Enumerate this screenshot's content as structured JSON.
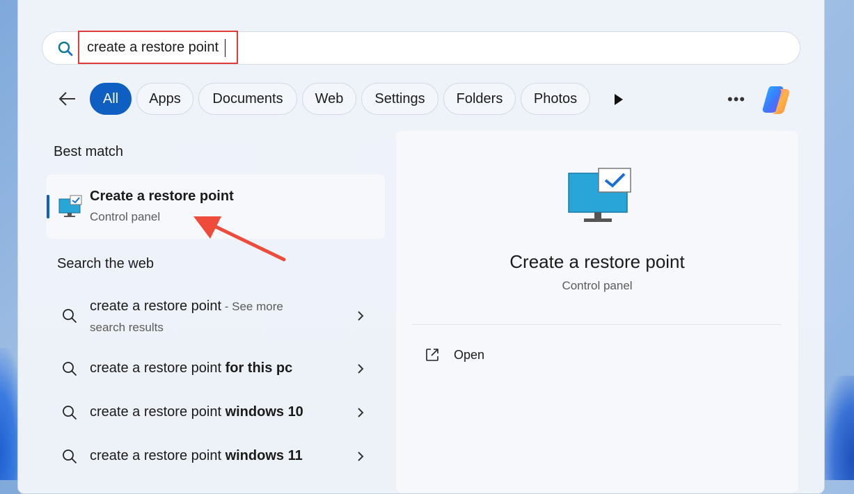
{
  "search": {
    "query": "create a restore point"
  },
  "filters": [
    "All",
    "Apps",
    "Documents",
    "Web",
    "Settings",
    "Folders",
    "Photos"
  ],
  "best_match": {
    "heading": "Best match",
    "title": "Create a restore point",
    "subtitle": "Control panel"
  },
  "web": {
    "heading": "Search the web",
    "items": [
      {
        "text": "create a restore point",
        "bold": "",
        "extra": " - See more",
        "extra2": "search results"
      },
      {
        "text": "create a restore point ",
        "bold": "for this pc"
      },
      {
        "text": "create a restore point ",
        "bold": "windows 10"
      },
      {
        "text": "create a restore point ",
        "bold": "windows 11"
      }
    ]
  },
  "preview": {
    "title": "Create a restore point",
    "subtitle": "Control panel",
    "action": "Open"
  },
  "colors": {
    "accent": "#0f5fc2",
    "highlight": "#e03a3a"
  },
  "icons": [
    "search-icon",
    "back-arrow-icon",
    "play-icon",
    "more-icon",
    "copilot-icon",
    "restore-point-icon",
    "chevron-right-icon",
    "open-external-icon"
  ]
}
